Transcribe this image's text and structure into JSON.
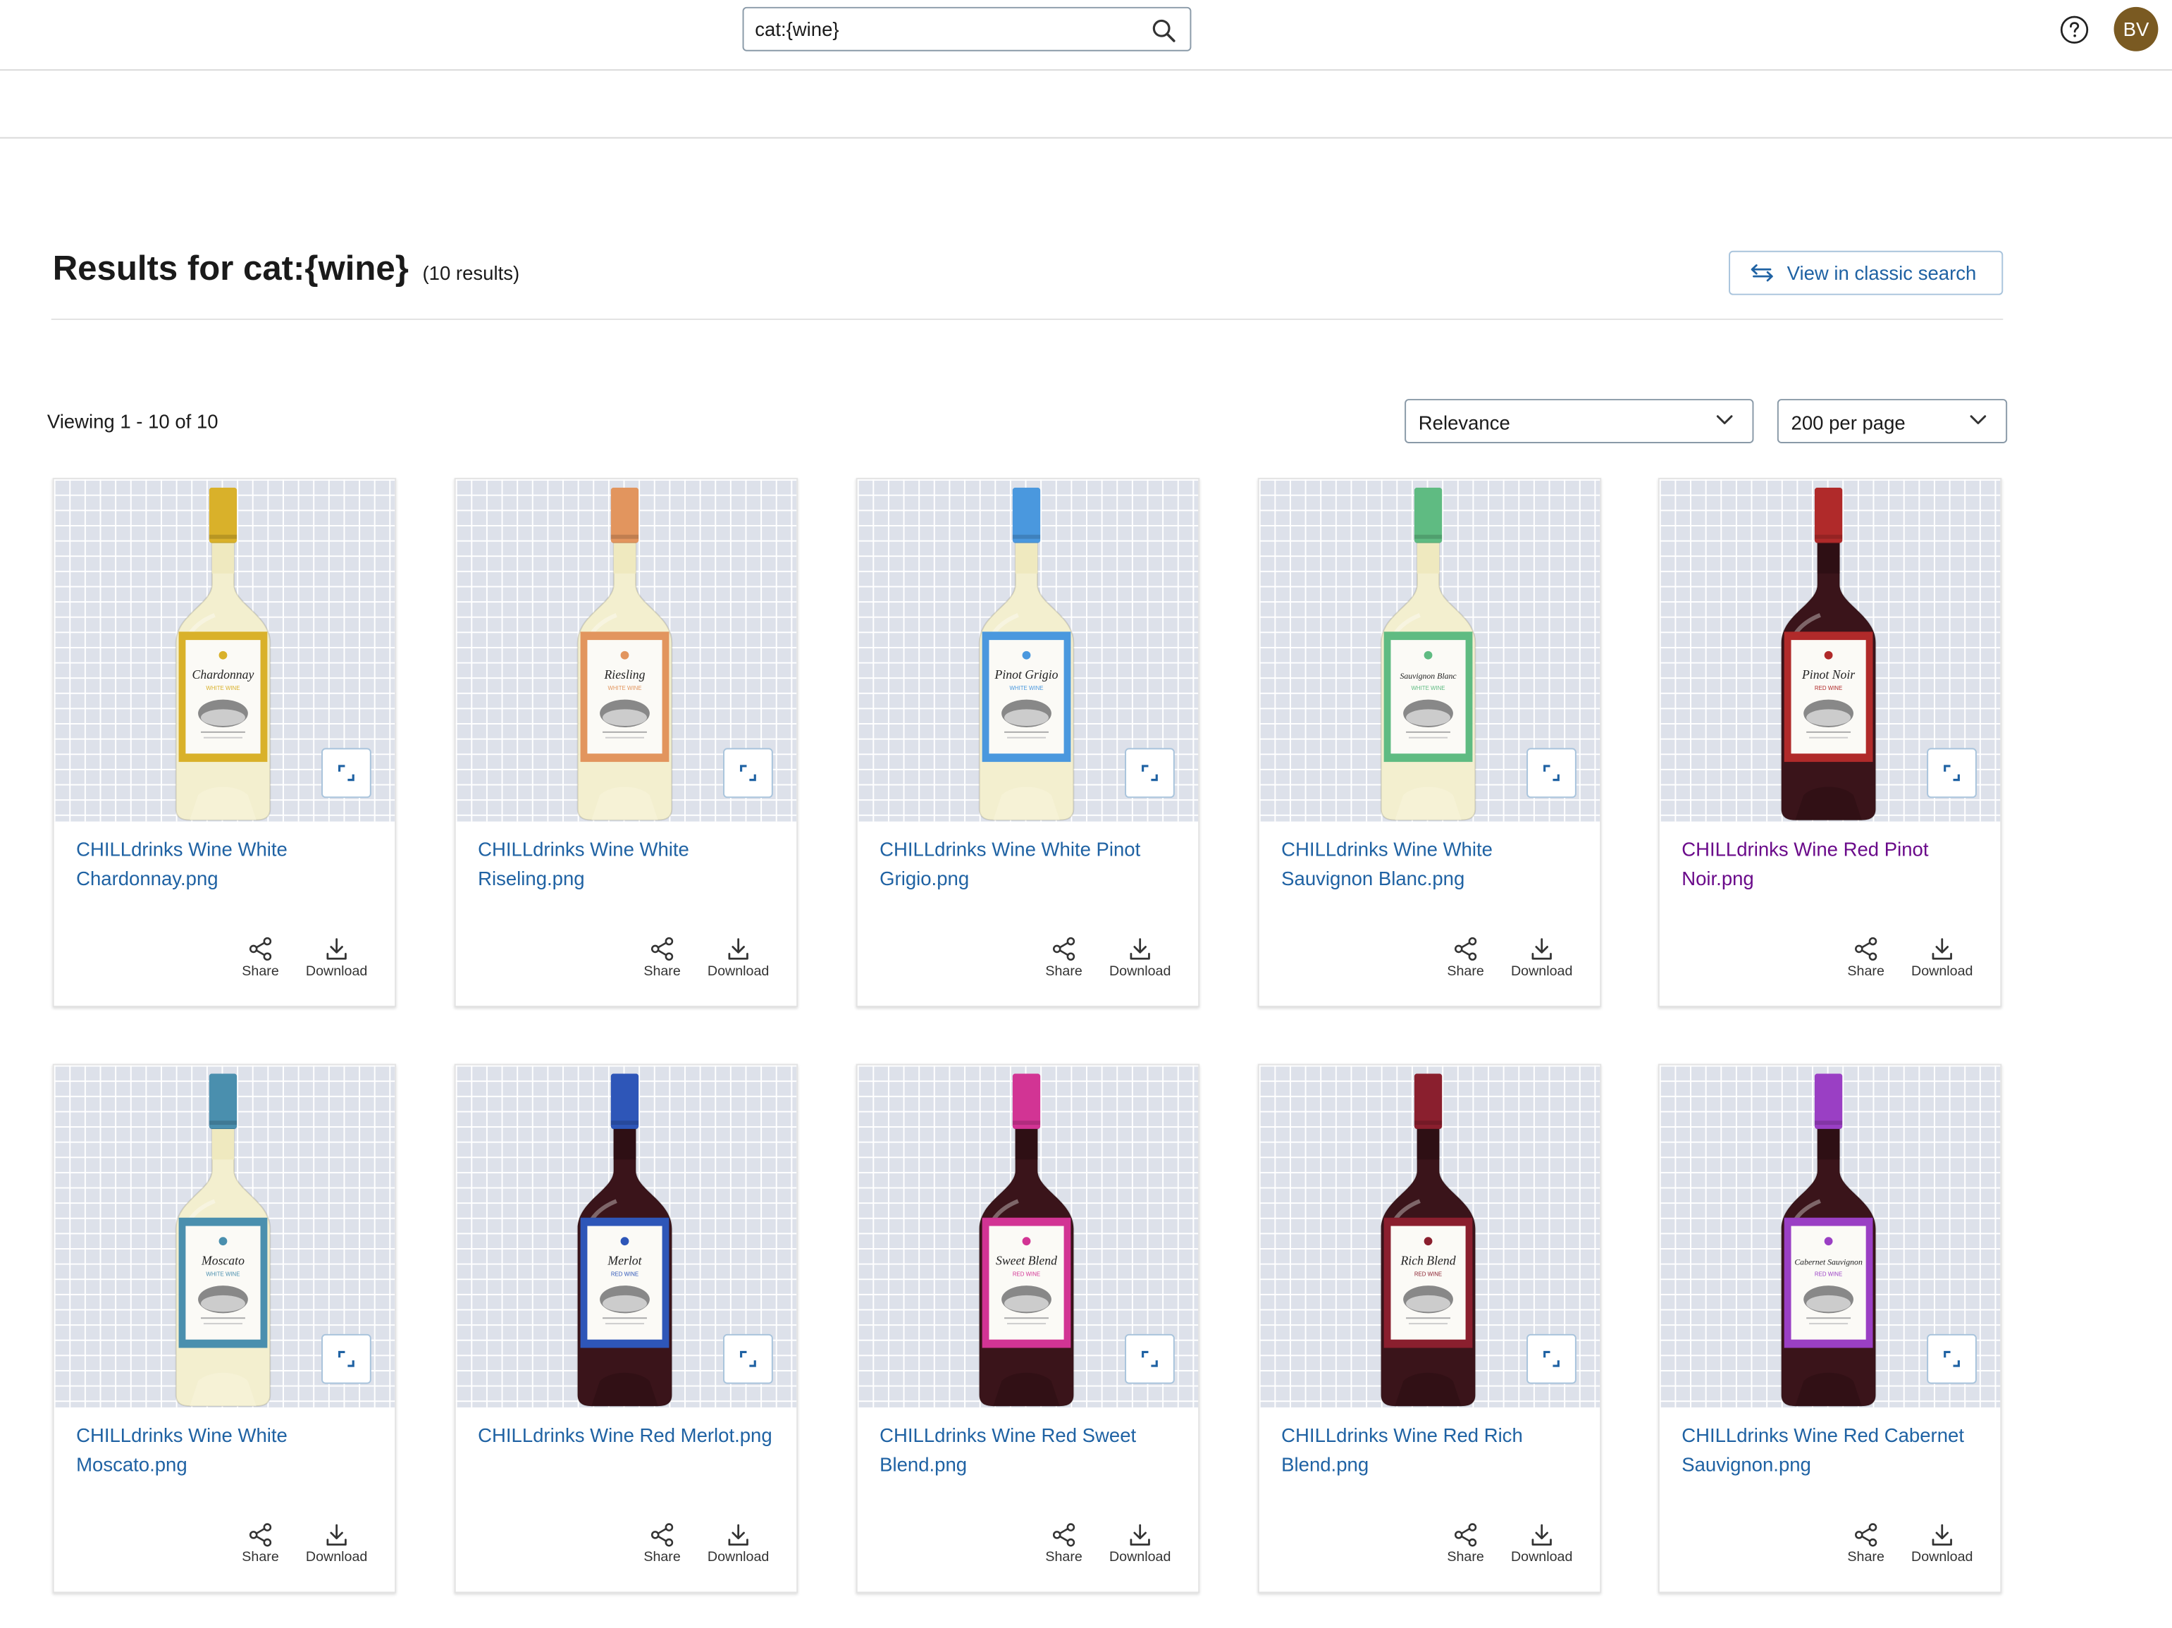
{
  "header": {
    "search_value": "cat:{wine}",
    "avatar_initials": "BV"
  },
  "results": {
    "title": "Results for cat:{wine}",
    "count": "(10 results)",
    "classic_button": "View in classic search",
    "viewing": "Viewing 1 - 10 of 10"
  },
  "controls": {
    "sort_value": "Relevance",
    "per_page_value": "200 per page"
  },
  "card_actions": {
    "share": "Share",
    "download": "Download"
  },
  "assets": [
    {
      "title": "CHILLdrinks Wine White Chardonnay.png",
      "label": "Chardonnay",
      "type": "WHITE WINE",
      "accent": "#d9b12a",
      "wine": "white"
    },
    {
      "title": "CHILLdrinks Wine White Riseling.png",
      "label": "Riesling",
      "type": "WHITE WINE",
      "accent": "#e2955e",
      "wine": "white"
    },
    {
      "title": "CHILLdrinks Wine White Pinot Grigio.png",
      "label": "Pinot Grigio",
      "type": "WHITE WINE",
      "accent": "#4a98de",
      "wine": "white"
    },
    {
      "title": "CHILLdrinks Wine White Sauvignon Blanc.png",
      "label": "Sauvignon Blanc",
      "type": "WHITE WINE",
      "accent": "#5fbb82",
      "wine": "white"
    },
    {
      "title": "CHILLdrinks Wine Red Pinot Noir.png",
      "label": "Pinot Noir",
      "type": "RED WINE",
      "accent": "#b02a2a",
      "wine": "red",
      "visited": true
    },
    {
      "title": "CHILLdrinks Wine White Moscato.png",
      "label": "Moscato",
      "type": "WHITE WINE",
      "accent": "#4a8fae",
      "wine": "white"
    },
    {
      "title": "CHILLdrinks Wine Red Merlot.png",
      "label": "Merlot",
      "type": "RED WINE",
      "accent": "#2e56b8",
      "wine": "red"
    },
    {
      "title": "CHILLdrinks Wine Red Sweet Blend.png",
      "label": "Sweet Blend",
      "type": "RED WINE",
      "accent": "#d23494",
      "wine": "red"
    },
    {
      "title": "CHILLdrinks Wine Red Rich Blend.png",
      "label": "Rich Blend",
      "type": "RED WINE",
      "accent": "#8a1f2e",
      "wine": "red"
    },
    {
      "title": "CHILLdrinks Wine Red Cabernet Sauvignon.png",
      "label": "Cabernet Sauvignon",
      "type": "RED WINE",
      "accent": "#9a3fc4",
      "wine": "red"
    }
  ]
}
